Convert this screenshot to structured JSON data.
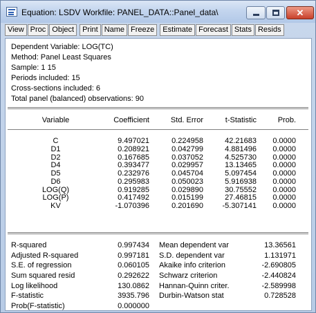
{
  "window": {
    "title": "Equation: LSDV   Workfile: PANEL_DATA::Panel_data\\",
    "controls": {
      "close": "✕"
    }
  },
  "toolbar": [
    "View",
    "Proc",
    "Object",
    "Print",
    "Name",
    "Freeze",
    "Estimate",
    "Forecast",
    "Stats",
    "Resids"
  ],
  "header_lines": [
    "Dependent Variable: LOG(TC)",
    "Method: Panel Least Squares",
    "Sample: 1 15",
    "Periods included: 15",
    "Cross-sections included: 6",
    "Total panel (balanced) observations: 90"
  ],
  "coef_table": {
    "columns": [
      "Variable",
      "Coefficient",
      "Std. Error",
      "t-Statistic",
      "Prob."
    ],
    "rows": [
      [
        "C",
        "9.497021",
        "0.224958",
        "42.21683",
        "0.0000"
      ],
      [
        "D1",
        "0.208921",
        "0.042799",
        "4.881496",
        "0.0000"
      ],
      [
        "D2",
        "0.167685",
        "0.037052",
        "4.525730",
        "0.0000"
      ],
      [
        "D4",
        "0.393477",
        "0.029957",
        "13.13465",
        "0.0000"
      ],
      [
        "D5",
        "0.232976",
        "0.045704",
        "5.097454",
        "0.0000"
      ],
      [
        "D6",
        "0.295983",
        "0.050023",
        "5.916938",
        "0.0000"
      ],
      [
        "LOG(Q)",
        "0.919285",
        "0.029890",
        "30.75552",
        "0.0000"
      ],
      [
        "LOG(P)",
        "0.417492",
        "0.015199",
        "27.46815",
        "0.0000"
      ],
      [
        "KV",
        "-1.070396",
        "0.201690",
        "-5.307141",
        "0.0000"
      ]
    ]
  },
  "stats_table": {
    "rows": [
      [
        "R-squared",
        "0.997434",
        "Mean dependent var",
        "13.36561"
      ],
      [
        "Adjusted R-squared",
        "0.997181",
        "S.D. dependent var",
        "1.131971"
      ],
      [
        "S.E. of regression",
        "0.060105",
        "Akaike info criterion",
        "-2.690805"
      ],
      [
        "Sum squared resid",
        "0.292622",
        "Schwarz criterion",
        "-2.440824"
      ],
      [
        "Log likelihood",
        "130.0862",
        "Hannan-Quinn criter.",
        "-2.589998"
      ],
      [
        "F-statistic",
        "3935.796",
        "Durbin-Watson stat",
        "0.728528"
      ],
      [
        "Prob(F-statistic)",
        "0.000000",
        "",
        ""
      ]
    ]
  }
}
